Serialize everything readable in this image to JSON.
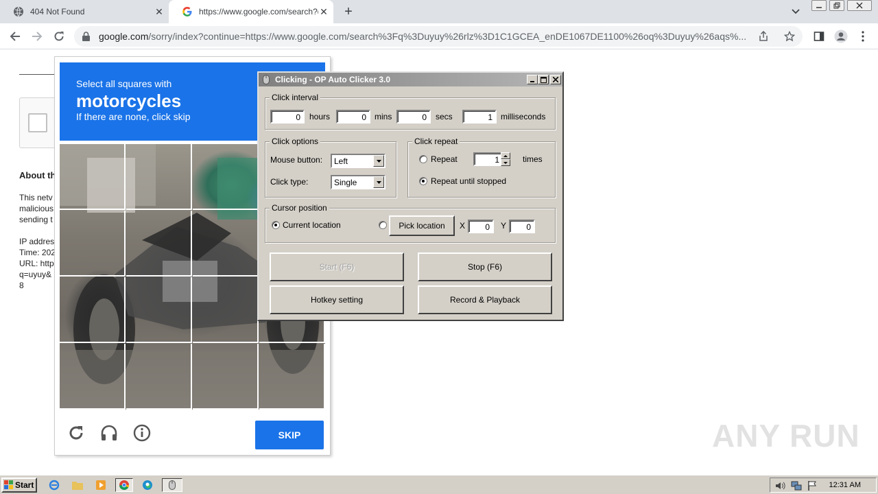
{
  "browser": {
    "tabs": [
      {
        "title": "404 Not Found",
        "active": false
      },
      {
        "title": "https://www.google.com/search?q=",
        "active": true
      }
    ],
    "url_host": "google.com",
    "url_rest": "/sorry/index?continue=https://www.google.com/search%3Fq%3Duyuy%26rlz%3D1C1GCEA_enDE1067DE1100%26oq%3Duyuy%26aqs%..."
  },
  "page": {
    "about_heading": "About th",
    "para1": "This netv\nmalicious\nsending t",
    "para2": "IP addres\nTime: 202\nURL: http\nq=uyuy&\n8"
  },
  "captcha": {
    "instruction": "Select all squares with",
    "object": "motorcycles",
    "hint": "If there are none, click skip",
    "skip_label": "SKIP",
    "accent_color": "#1a73e8"
  },
  "clicker": {
    "window_title": "Clicking - OP Auto Clicker 3.0",
    "interval": {
      "group_label": "Click interval",
      "hours_value": "0",
      "hours_label": "hours",
      "mins_value": "0",
      "mins_label": "mins",
      "secs_value": "0",
      "secs_label": "secs",
      "ms_value": "1",
      "ms_label": "milliseconds"
    },
    "options": {
      "group_label": "Click options",
      "mouse_button_label": "Mouse button:",
      "mouse_button_value": "Left",
      "click_type_label": "Click type:",
      "click_type_value": "Single"
    },
    "repeat": {
      "group_label": "Click repeat",
      "repeat_label": "Repeat",
      "repeat_value": "1",
      "times_label": "times",
      "until_stopped_label": "Repeat until stopped",
      "selected": "until_stopped"
    },
    "cursor": {
      "group_label": "Cursor position",
      "current_label": "Current location",
      "pick_label": "Pick location",
      "x_label": "X",
      "x_value": "0",
      "y_label": "Y",
      "y_value": "0",
      "selected": "current"
    },
    "buttons": {
      "start": "Start (F6)",
      "stop": "Stop (F6)",
      "hotkey": "Hotkey setting",
      "record": "Record & Playback"
    }
  },
  "watermark": "ANY RUN",
  "taskbar": {
    "start_label": "Start",
    "clock": "12:31 AM"
  }
}
